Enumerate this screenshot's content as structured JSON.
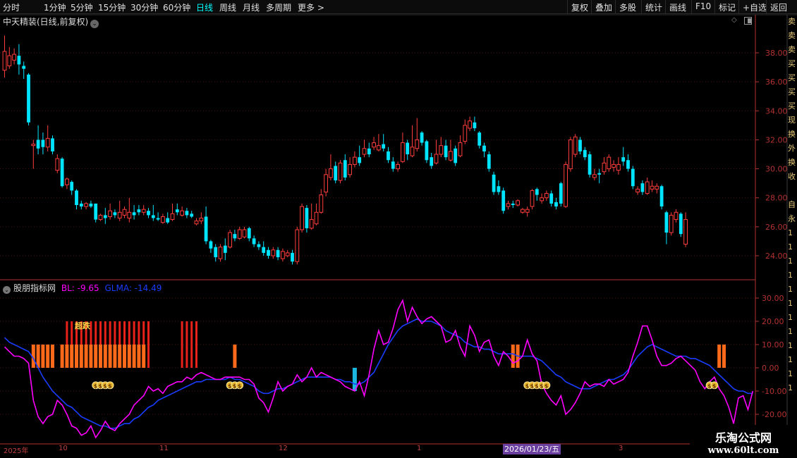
{
  "toolbar": {
    "timeframes": [
      {
        "label": "分时"
      },
      {
        "label": "1分钟"
      },
      {
        "label": "5分钟"
      },
      {
        "label": "15分钟"
      },
      {
        "label": "30分钟"
      },
      {
        "label": "60分钟"
      },
      {
        "label": "日线",
        "active": true
      },
      {
        "label": "周线"
      },
      {
        "label": "月线"
      },
      {
        "label": "多周期"
      },
      {
        "label": "更多 >"
      }
    ],
    "right_buttons": [
      "复权",
      "叠加",
      "多股",
      "统计",
      "画线",
      "F10",
      "标记",
      "+自选",
      "返回"
    ]
  },
  "main_chart": {
    "title": "中天精装(日线,前复权)",
    "price_axis": [
      "38.00",
      "36.00",
      "34.00",
      "32.00",
      "30.00",
      "28.00",
      "26.00",
      "24.00"
    ],
    "candles": [
      [
        1,
        36.8,
        38.1,
        36.3,
        39.2
      ],
      [
        1,
        37.1,
        37.8,
        36.9,
        38.4
      ],
      [
        1,
        37.5,
        37.9,
        37.2,
        38.3
      ],
      [
        0,
        37.8,
        37.2,
        36.5,
        38.6
      ],
      [
        0,
        37.1,
        36.9,
        36.2,
        37.4
      ],
      [
        0,
        36.5,
        33.2,
        33.0,
        36.6
      ],
      [
        1,
        31.6,
        31.7,
        30.0,
        32.0
      ],
      [
        0,
        32.0,
        31.4,
        31.0,
        33.0
      ],
      [
        0,
        32.0,
        31.5,
        31.0,
        32.5
      ],
      [
        1,
        31.5,
        32.1,
        31.2,
        33.0
      ],
      [
        0,
        32.1,
        31.2,
        31.0,
        32.3
      ],
      [
        1,
        29.9,
        30.7,
        29.7,
        31.0
      ],
      [
        0,
        30.7,
        28.8,
        28.7,
        30.8
      ],
      [
        1,
        28.9,
        29.3,
        28.6,
        29.4
      ],
      [
        0,
        29.1,
        28.5,
        28.2,
        29.2
      ],
      [
        0,
        28.5,
        27.5,
        27.2,
        28.6
      ],
      [
        0,
        27.6,
        27.4,
        27.2,
        27.8
      ],
      [
        1,
        27.4,
        27.6,
        27.2,
        27.7
      ],
      [
        0,
        27.6,
        27.4,
        27.3,
        27.8
      ],
      [
        0,
        27.6,
        26.5,
        26.3,
        27.6
      ],
      [
        1,
        26.5,
        26.8,
        26.4,
        26.9
      ],
      [
        0,
        26.8,
        26.6,
        26.2,
        27.3
      ],
      [
        1,
        26.7,
        27.1,
        26.5,
        27.6
      ],
      [
        0,
        27.0,
        26.8,
        26.6,
        27.2
      ],
      [
        1,
        26.6,
        27.0,
        26.4,
        27.8
      ],
      [
        1,
        26.8,
        27.2,
        26.6,
        27.4
      ],
      [
        1,
        26.6,
        27.0,
        26.3,
        28.0
      ],
      [
        0,
        27.0,
        26.8,
        26.5,
        27.5
      ],
      [
        0,
        27.2,
        27.0,
        26.8,
        27.5
      ],
      [
        1,
        27.0,
        27.2,
        26.8,
        27.5
      ],
      [
        0,
        27.1,
        26.8,
        26.6,
        27.3
      ],
      [
        0,
        26.8,
        26.6,
        26.4,
        27.5
      ],
      [
        0,
        26.6,
        26.5,
        26.4,
        27.0
      ],
      [
        1,
        26.3,
        26.7,
        26.2,
        26.9
      ],
      [
        0,
        26.6,
        26.3,
        26.2,
        27.0
      ],
      [
        1,
        26.5,
        26.9,
        26.4,
        27.6
      ],
      [
        0,
        27.2,
        27.0,
        26.8,
        27.6
      ],
      [
        1,
        26.8,
        27.1,
        26.7,
        27.4
      ],
      [
        0,
        27.1,
        26.8,
        26.6,
        27.3
      ],
      [
        0,
        26.9,
        26.7,
        26.6,
        27.1
      ],
      [
        1,
        26.2,
        26.4,
        26.1,
        26.6
      ],
      [
        1,
        26.4,
        26.6,
        26.2,
        27.0
      ],
      [
        0,
        26.7,
        25.0,
        24.8,
        27.4
      ],
      [
        0,
        25.0,
        24.5,
        24.2,
        25.1
      ],
      [
        0,
        24.6,
        23.9,
        23.6,
        24.8
      ],
      [
        1,
        23.8,
        24.6,
        23.6,
        24.8
      ],
      [
        0,
        24.7,
        24.2,
        23.7,
        25.2
      ],
      [
        1,
        24.6,
        25.6,
        24.5,
        25.8
      ],
      [
        0,
        25.5,
        25.2,
        25.0,
        25.8
      ],
      [
        1,
        25.2,
        25.8,
        25.1,
        26.0
      ],
      [
        1,
        25.3,
        25.8,
        25.2,
        26.0
      ],
      [
        0,
        25.9,
        25.2,
        25.0,
        26.0
      ],
      [
        0,
        25.2,
        24.8,
        24.6,
        25.4
      ],
      [
        0,
        24.8,
        24.6,
        24.4,
        25.0
      ],
      [
        0,
        24.6,
        24.2,
        24.0,
        25.0
      ],
      [
        0,
        24.4,
        24.0,
        23.8,
        24.6
      ],
      [
        1,
        24.0,
        24.4,
        23.8,
        24.6
      ],
      [
        0,
        24.4,
        23.9,
        23.7,
        24.6
      ],
      [
        1,
        23.8,
        24.3,
        23.6,
        24.5
      ],
      [
        1,
        24.2,
        24.0,
        23.9,
        24.4
      ],
      [
        0,
        24.2,
        23.6,
        23.4,
        24.4
      ],
      [
        1,
        23.6,
        25.8,
        23.4,
        26.0
      ],
      [
        1,
        25.8,
        27.4,
        25.6,
        27.6
      ],
      [
        0,
        27.3,
        25.9,
        25.6,
        27.5
      ],
      [
        1,
        25.9,
        26.5,
        25.8,
        27.6
      ],
      [
        1,
        26.2,
        27.0,
        26.1,
        27.6
      ],
      [
        1,
        27.0,
        28.2,
        26.9,
        28.6
      ],
      [
        1,
        28.4,
        29.6,
        28.1,
        30.0
      ],
      [
        1,
        29.4,
        30.0,
        29.2,
        31.0
      ],
      [
        0,
        30.2,
        29.2,
        29.0,
        30.5
      ],
      [
        1,
        29.2,
        30.4,
        29.0,
        30.6
      ],
      [
        0,
        30.6,
        29.4,
        29.2,
        31.0
      ],
      [
        1,
        29.6,
        30.3,
        29.4,
        30.8
      ],
      [
        1,
        30.3,
        30.8,
        30.1,
        31.2
      ],
      [
        0,
        30.8,
        30.4,
        30.2,
        31.6
      ],
      [
        1,
        31.0,
        31.4,
        30.8,
        32.0
      ],
      [
        0,
        31.4,
        31.0,
        30.8,
        31.8
      ],
      [
        1,
        31.5,
        31.8,
        31.3,
        32.2
      ],
      [
        1,
        31.3,
        31.6,
        31.2,
        32.4
      ],
      [
        0,
        31.7,
        31.4,
        31.2,
        32.4
      ],
      [
        0,
        31.2,
        30.6,
        30.4,
        31.5
      ],
      [
        0,
        30.5,
        30.0,
        29.8,
        30.8
      ],
      [
        1,
        30.0,
        30.3,
        29.8,
        30.5
      ],
      [
        1,
        30.5,
        31.8,
        30.4,
        32.5
      ],
      [
        0,
        31.8,
        31.0,
        30.6,
        32.0
      ],
      [
        1,
        30.9,
        31.5,
        30.8,
        33.0
      ],
      [
        1,
        31.4,
        32.0,
        31.2,
        33.5
      ],
      [
        0,
        32.5,
        31.8,
        31.6,
        32.6
      ],
      [
        0,
        31.9,
        30.6,
        30.4,
        32.0
      ],
      [
        0,
        30.8,
        30.2,
        30.0,
        31.1
      ],
      [
        1,
        30.4,
        31.0,
        30.3,
        32.0
      ],
      [
        1,
        31.0,
        31.6,
        30.8,
        32.2
      ],
      [
        0,
        31.6,
        30.8,
        30.6,
        32.0
      ],
      [
        1,
        30.6,
        31.2,
        30.5,
        32.0
      ],
      [
        0,
        31.4,
        30.4,
        30.2,
        31.6
      ],
      [
        1,
        30.9,
        31.8,
        30.8,
        32.3
      ],
      [
        1,
        31.9,
        33.0,
        31.7,
        33.4
      ],
      [
        1,
        32.8,
        33.3,
        32.6,
        33.6
      ],
      [
        0,
        33.2,
        32.8,
        32.6,
        33.6
      ],
      [
        0,
        32.5,
        31.6,
        31.4,
        32.6
      ],
      [
        0,
        31.6,
        31.2,
        30.8,
        31.8
      ],
      [
        0,
        31.0,
        30.0,
        29.8,
        31.2
      ],
      [
        0,
        29.6,
        28.4,
        28.2,
        29.8
      ],
      [
        0,
        28.8,
        28.4,
        28.2,
        29.2
      ],
      [
        0,
        28.5,
        27.1,
        26.9,
        28.7
      ],
      [
        1,
        27.4,
        27.6,
        27.2,
        27.8
      ],
      [
        0,
        27.6,
        27.5,
        27.3,
        27.8
      ],
      [
        1,
        27.5,
        27.8,
        27.4,
        27.9
      ],
      [
        1,
        27.0,
        27.2,
        26.9,
        27.3
      ],
      [
        1,
        27.2,
        27.0,
        26.7,
        27.4
      ],
      [
        1,
        27.4,
        28.5,
        27.2,
        28.6
      ],
      [
        0,
        28.6,
        28.2,
        27.8,
        28.7
      ],
      [
        1,
        27.8,
        28.0,
        27.6,
        28.3
      ],
      [
        1,
        28.0,
        28.3,
        27.8,
        28.5
      ],
      [
        0,
        28.3,
        27.6,
        27.4,
        28.5
      ],
      [
        0,
        27.7,
        27.4,
        27.2,
        28.0
      ],
      [
        0,
        29.0,
        27.6,
        27.4,
        29.1
      ],
      [
        1,
        27.4,
        30.3,
        27.3,
        30.5
      ],
      [
        1,
        30.0,
        32.0,
        29.8,
        32.2
      ],
      [
        1,
        31.0,
        32.2,
        30.8,
        32.4
      ],
      [
        0,
        32.0,
        31.2,
        31.0,
        32.2
      ],
      [
        0,
        31.3,
        30.8,
        30.6,
        31.5
      ],
      [
        0,
        31.0,
        29.6,
        29.4,
        31.2
      ],
      [
        1,
        29.4,
        29.6,
        29.2,
        30.0
      ],
      [
        0,
        29.7,
        29.6,
        29.0,
        30.0
      ],
      [
        1,
        29.8,
        30.4,
        29.6,
        30.8
      ],
      [
        1,
        30.0,
        30.8,
        29.8,
        31.0
      ],
      [
        1,
        30.1,
        30.3,
        29.8,
        30.6
      ],
      [
        1,
        29.9,
        30.3,
        29.6,
        30.8
      ],
      [
        0,
        30.8,
        30.5,
        30.2,
        31.5
      ],
      [
        0,
        30.6,
        30.0,
        29.8,
        31.0
      ],
      [
        0,
        30.0,
        28.8,
        28.6,
        30.2
      ],
      [
        1,
        28.4,
        28.6,
        28.2,
        28.8
      ],
      [
        0,
        29.0,
        28.4,
        28.2,
        29.2
      ],
      [
        1,
        28.3,
        29.1,
        28.2,
        29.4
      ],
      [
        1,
        28.6,
        28.8,
        28.4,
        29.2
      ],
      [
        1,
        28.6,
        28.8,
        28.3,
        29.0
      ],
      [
        0,
        28.8,
        27.4,
        27.2,
        28.9
      ],
      [
        0,
        27.0,
        25.6,
        24.8,
        27.1
      ],
      [
        1,
        25.6,
        26.8,
        25.4,
        27.0
      ],
      [
        1,
        26.5,
        27.0,
        26.3,
        27.2
      ],
      [
        0,
        26.9,
        25.5,
        25.3,
        27.0
      ],
      [
        1,
        24.8,
        26.5,
        24.6,
        27.0
      ]
    ]
  },
  "indicator": {
    "name": "股朋指标网",
    "bl_label": "BL: -9.65",
    "glma_label": "GLMA: -14.49",
    "signal_label": "超跌",
    "axis": [
      "30.00",
      "20.00",
      "10.00",
      "0.00",
      "-10.00",
      "-20.00"
    ],
    "bl_values": [
      9,
      7,
      5,
      5,
      4,
      2,
      -14,
      -21,
      -24,
      -21,
      -20,
      -14,
      -16,
      -20,
      -25,
      -26,
      -29,
      -28,
      -25,
      -30,
      -27,
      -23,
      -26,
      -27,
      -24,
      -22,
      -20,
      -16,
      -14,
      -12,
      -8,
      -10,
      -9,
      -11,
      -8,
      -7,
      -6,
      -6,
      -4,
      -5,
      -3,
      -2,
      -3,
      -4,
      -5,
      -5,
      -4,
      -4,
      -4,
      -4,
      -5,
      -5,
      -7,
      -13,
      -15,
      -19,
      -13,
      -6,
      -10,
      -8,
      -7,
      -3,
      -6,
      -4,
      0,
      -4,
      -2,
      -3,
      -4,
      -5,
      -6,
      -8,
      -9,
      -10,
      -6,
      -12,
      -3,
      8,
      16,
      10,
      11,
      17,
      25,
      29,
      20,
      26,
      22,
      19,
      21,
      22,
      20,
      18,
      11,
      12,
      16,
      9,
      5,
      18,
      14,
      7,
      11,
      12,
      5,
      1,
      7,
      5,
      2,
      3,
      5,
      12,
      6,
      3,
      -7,
      -11,
      -14,
      -16,
      -12,
      -20,
      -18,
      -15,
      -11,
      -6,
      -8,
      -7,
      -7,
      -8,
      -5,
      -7,
      -6,
      -5,
      -2,
      5,
      11,
      18,
      18,
      12,
      5,
      1,
      1,
      2,
      4,
      5,
      3,
      1,
      -1,
      -6,
      -9,
      -6,
      -4,
      -9,
      -12,
      -17,
      -24,
      -13,
      -12,
      -18,
      -10
    ],
    "glma_values": [
      13,
      11,
      10,
      9,
      8,
      7,
      4,
      0,
      -4,
      -7,
      -10,
      -12,
      -14,
      -16,
      -17,
      -19,
      -21,
      -22,
      -23,
      -24,
      -25,
      -25,
      -26,
      -26,
      -25,
      -24,
      -24,
      -22,
      -21,
      -19,
      -17,
      -16,
      -14,
      -13,
      -12,
      -11,
      -10,
      -9,
      -8,
      -7,
      -6,
      -6,
      -5,
      -5,
      -5,
      -5,
      -5,
      -4,
      -5,
      -5,
      -6,
      -7,
      -8,
      -10,
      -11,
      -11,
      -10,
      -9,
      -9,
      -8,
      -7,
      -6,
      -5,
      -4,
      -4,
      -4,
      -4,
      -4,
      -4,
      -5,
      -5,
      -6,
      -6,
      -7,
      -7,
      -6,
      -4,
      -2,
      2,
      6,
      10,
      13,
      16,
      18,
      19,
      20,
      21,
      20,
      20,
      20,
      19,
      18,
      16,
      15,
      14,
      13,
      11,
      10,
      9,
      9,
      8,
      8,
      7,
      6,
      6,
      6,
      6,
      5,
      5,
      5,
      5,
      4,
      3,
      1,
      -1,
      -3,
      -4,
      -6,
      -7,
      -8,
      -9,
      -9,
      -9,
      -8,
      -7,
      -6,
      -5,
      -5,
      -4,
      -3,
      -1,
      2,
      5,
      7,
      9,
      10,
      9,
      8,
      7,
      6,
      5,
      5,
      5,
      4,
      4,
      3,
      2,
      1,
      -1,
      -3,
      -5,
      -7,
      -9,
      -10,
      -10,
      -11,
      -11
    ],
    "red_bar_ranges": [
      [
        13,
        30
      ],
      [
        37,
        40
      ]
    ],
    "orange_bars": [
      6,
      7,
      8,
      9,
      10,
      12,
      13,
      14,
      15,
      16,
      17,
      18,
      19,
      20,
      21,
      22,
      23,
      24,
      25,
      26,
      27,
      28,
      29,
      48,
      106,
      107,
      149,
      150
    ],
    "money_bags": [
      19,
      20,
      21,
      22,
      47,
      48,
      49,
      109,
      110,
      111,
      112,
      113,
      147,
      148
    ],
    "cyan_bars": [
      73
    ]
  },
  "dates": {
    "labels": [
      {
        "text": "2025年"
      },
      {
        "text": "10"
      },
      {
        "text": "11"
      },
      {
        "text": "12"
      },
      {
        "text": "1"
      },
      {
        "text": "3"
      }
    ],
    "highlight": "2026/01/23/五"
  },
  "right_strip": [
    "卖",
    "卖",
    "卖",
    "买",
    "买",
    "买",
    "买",
    "现",
    "换",
    "外",
    "换",
    "收",
    "",
    "自",
    "永",
    "1",
    "1",
    "1",
    "1",
    "1",
    "1",
    "1",
    "1",
    "1",
    "1",
    "1",
    "1"
  ],
  "watermark": {
    "line1": "乐淘公式网",
    "line2": "www.60lt.com"
  },
  "colors": {
    "up": "#ff3d3d",
    "down": "#00e5ff",
    "bl": "#ff00ff",
    "glma": "#1a3cff",
    "signal_red": "#e8221a",
    "signal_orange": "#ff6a1a",
    "axis_red": "#b43232"
  }
}
